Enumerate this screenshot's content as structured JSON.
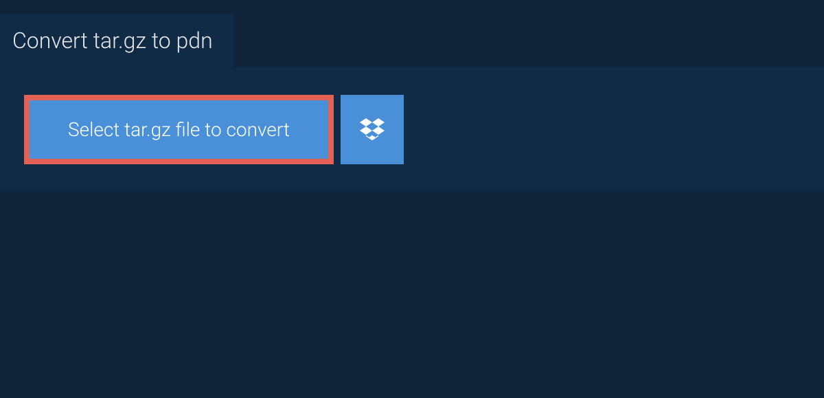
{
  "tab": {
    "title": "Convert tar.gz to pdn"
  },
  "buttons": {
    "select_file_label": "Select tar.gz file to convert"
  },
  "icons": {
    "dropbox": "dropbox-icon"
  }
}
